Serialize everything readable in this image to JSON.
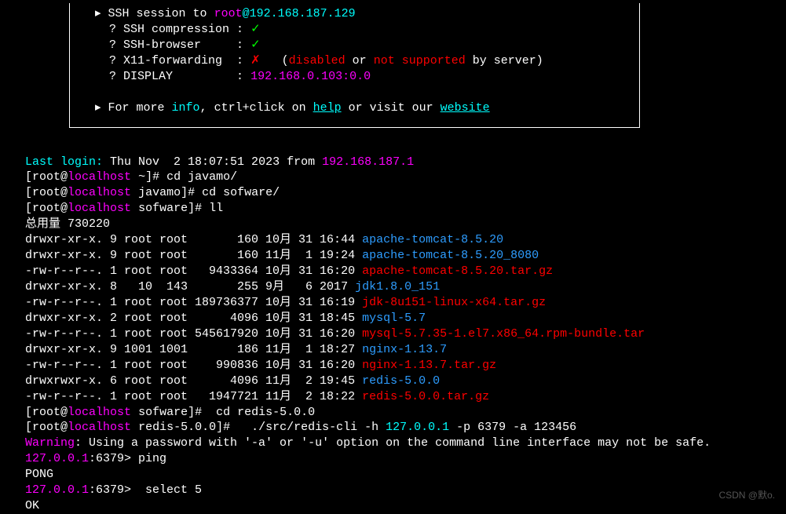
{
  "box": {
    "arrow1": "▸",
    "ssh_to": " SSH session to ",
    "user": "root",
    "at": "@",
    "host": "192.168.187.129",
    "q": "?",
    "comp_label": " SSH compression : ",
    "comp_val": "✓",
    "browser_label": " SSH-browser     : ",
    "browser_val": "✓",
    "x11_label": " X11-forwarding  : ",
    "x11_val": "✗",
    "x11_note_open": "   (",
    "x11_disabled": "disabled",
    "x11_or": " or ",
    "x11_not": "not supported",
    "x11_by": " by server)",
    "display_label": " DISPLAY         : ",
    "display_val": "192.168.0.103:0.0",
    "arrow2": "▸",
    "more1": " For more ",
    "info": "info",
    "more2": ", ctrl+click on ",
    "help": "help",
    "more3": " or visit our ",
    "website": "website"
  },
  "login": {
    "last_login": "Last login:",
    "login_rest": " Thu Nov  2 18:07:51 2023 from ",
    "login_ip": "192.168.187.1"
  },
  "p1": {
    "bracket_open": "[",
    "user": "root",
    "at": "@",
    "host": "localhost",
    "dir": " ~]# ",
    "cmd": "cd javamo/"
  },
  "p2": {
    "bracket_open": "[",
    "user": "root",
    "at": "@",
    "host": "localhost",
    "dir": " javamo]# ",
    "cmd": "cd sofware/"
  },
  "p3": {
    "bracket_open": "[",
    "user": "root",
    "at": "@",
    "host": "localhost",
    "dir": " sofware]# ",
    "cmd": "ll"
  },
  "total": "总用量 730220",
  "ls": [
    {
      "perm": "drwxr-xr-x. 9 root root       160 10月 31 16:44 ",
      "name": "apache-tomcat-8.5.20",
      "cls": "blue"
    },
    {
      "perm": "drwxr-xr-x. 9 root root       160 11月  1 19:24 ",
      "name": "apache-tomcat-8.5.20_8080",
      "cls": "blue"
    },
    {
      "perm": "-rw-r--r--. 1 root root   9433364 10月 31 16:20 ",
      "name": "apache-tomcat-8.5.20.tar.gz",
      "cls": "red"
    },
    {
      "perm": "drwxr-xr-x. 8   10  143       255 9月   6 2017 ",
      "name": "jdk1.8.0_151",
      "cls": "blue"
    },
    {
      "perm": "-rw-r--r--. 1 root root 189736377 10月 31 16:19 ",
      "name": "jdk-8u151-linux-x64.tar.gz",
      "cls": "red"
    },
    {
      "perm": "drwxr-xr-x. 2 root root      4096 10月 31 18:45 ",
      "name": "mysql-5.7",
      "cls": "blue"
    },
    {
      "perm": "-rw-r--r--. 1 root root 545617920 10月 31 16:20 ",
      "name": "mysql-5.7.35-1.el7.x86_64.rpm-bundle.tar",
      "cls": "red"
    },
    {
      "perm": "drwxr-xr-x. 9 1001 1001       186 11月  1 18:27 ",
      "name": "nginx-1.13.7",
      "cls": "blue"
    },
    {
      "perm": "-rw-r--r--. 1 root root    990836 10月 31 16:20 ",
      "name": "nginx-1.13.7.tar.gz",
      "cls": "red"
    },
    {
      "perm": "drwxrwxr-x. 6 root root      4096 11月  2 19:45 ",
      "name": "redis-5.0.0",
      "cls": "blue"
    },
    {
      "perm": "-rw-r--r--. 1 root root   1947721 11月  2 18:22 ",
      "name": "redis-5.0.0.tar.gz",
      "cls": "red"
    }
  ],
  "p4": {
    "bracket_open": "[",
    "user": "root",
    "at": "@",
    "host": "localhost",
    "dir": " sofware]# ",
    "cmd": " cd redis-5.0.0"
  },
  "p5": {
    "bracket_open": "[",
    "user": "root",
    "at": "@",
    "host": "localhost",
    "dir": " redis-5.0.0]# ",
    "cmd1": "  ./src/redis-cli -h ",
    "ip": "127.0.0.1",
    "cmd2": " -p 6379 -a 123456"
  },
  "warning": {
    "label": "Warning",
    "text": ": Using a password with '-a' or '-u' option on the command line interface may not be safe."
  },
  "r1": {
    "ip": "127.0.0.1",
    "port": ":6379> ",
    "cmd": "ping"
  },
  "pong": "PONG",
  "r2": {
    "ip": "127.0.0.1",
    "port": ":6379> ",
    "cmd": " select 5"
  },
  "ok": "OK",
  "watermark": "CSDN @默o."
}
